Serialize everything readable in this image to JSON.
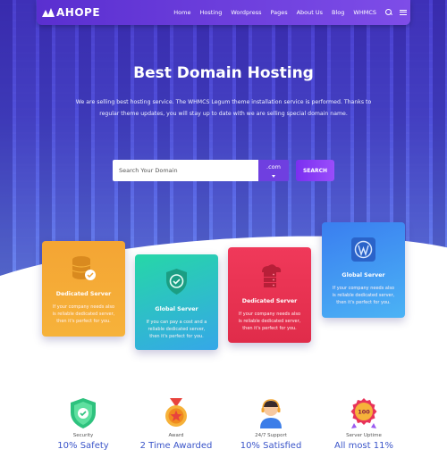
{
  "brand": {
    "logo_text": "AHOPE"
  },
  "nav": {
    "items": [
      "Home",
      "Hosting",
      "Wordpress",
      "Pages",
      "About Us",
      "Blog",
      "WHMCS"
    ]
  },
  "hero": {
    "title": "Best Domain Hosting",
    "description": "We are selling best hosting service. The WHMCS Legum theme installation service is performed. Thanks to regular theme updates, you will stay up to date with we are selling special domain name."
  },
  "search": {
    "placeholder": "Search Your Domain",
    "tld_value": ".com",
    "button_label": "SEARCH"
  },
  "cards": [
    {
      "title": "Dedicated Server",
      "description": "If your company needs also is reliable dedicated server, then it's perfect for you.",
      "icon": "database-check-icon",
      "colors": [
        "#f4a534",
        "#f6b23a"
      ]
    },
    {
      "title": "Global Server",
      "description": "If you can pay a cost and a reliable dedicated server, then it's perfect for you.",
      "icon": "shield-check-icon",
      "colors": [
        "#26d7a7",
        "#35a7e8"
      ]
    },
    {
      "title": "Dedicated Server",
      "description": "If your company needs also is reliable dedicated server, then it's perfect for you.",
      "icon": "cloud-server-icon",
      "colors": [
        "#f0395a",
        "#e02c4a"
      ]
    },
    {
      "title": "Global Server",
      "description": "If your company needs also is reliable dedicated server, then it's perfect for you.",
      "icon": "wordpress-icon",
      "colors": [
        "#3a7ef0",
        "#4bb3f5"
      ]
    }
  ],
  "features": [
    {
      "label": "Security",
      "value": "10% Safety",
      "icon": "shield-check-icon"
    },
    {
      "label": "Award",
      "value": "2 Time Awarded",
      "icon": "award-medal-icon"
    },
    {
      "label": "24/7 Support",
      "value": "10% Satisfied",
      "icon": "support-agent-icon"
    },
    {
      "label": "Server Uptime",
      "value": "All most 11%",
      "icon": "uptime-badge-icon"
    }
  ],
  "colors": {
    "accent": "#6f3fe0",
    "hero": "#4b49d6",
    "feature_value": "#3b55c9"
  }
}
